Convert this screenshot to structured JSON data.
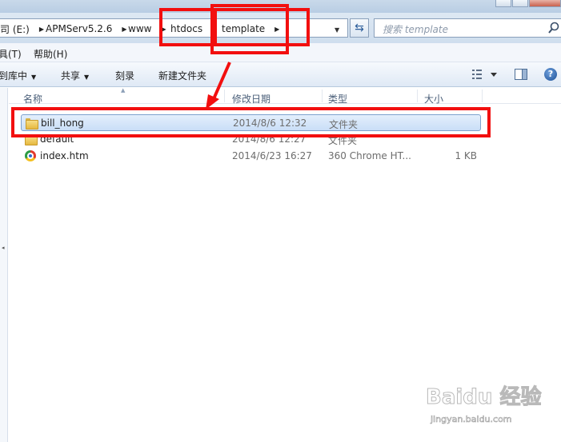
{
  "address": {
    "crumbs": [
      {
        "label": "司 (E:)"
      },
      {
        "label": "APMServ5.2.6"
      },
      {
        "label": "www"
      },
      {
        "label": "htdocs"
      },
      {
        "label": "template"
      }
    ]
  },
  "search": {
    "placeholder": "搜索 template"
  },
  "menu": {
    "tools": "具(T)",
    "help": "帮助(H)"
  },
  "toolbar": {
    "include_library": "到库中",
    "share": "共享",
    "burn": "刻录",
    "new_folder": "新建文件夹"
  },
  "columns": {
    "name": "名称",
    "date": "修改日期",
    "type": "类型",
    "size": "大小"
  },
  "files": [
    {
      "name": "bill_hong",
      "date": "2014/8/6 12:32",
      "type": "文件夹",
      "size": "",
      "icon": "folder-icon",
      "selected": true
    },
    {
      "name": "default",
      "date": "2014/8/6 12:27",
      "type": "文件夹",
      "size": "",
      "icon": "folder-icon",
      "selected": false
    },
    {
      "name": "index.htm",
      "date": "2014/6/23 16:27",
      "type": "360 Chrome HT...",
      "size": "1 KB",
      "icon": "chrome-html-icon",
      "selected": false
    }
  ],
  "watermark": {
    "logo": "Baidu 经验",
    "url": "jingyan.baidu.com"
  },
  "colors": {
    "annotation_red": "#f20f0f",
    "selection_border": "#7da2ce"
  }
}
